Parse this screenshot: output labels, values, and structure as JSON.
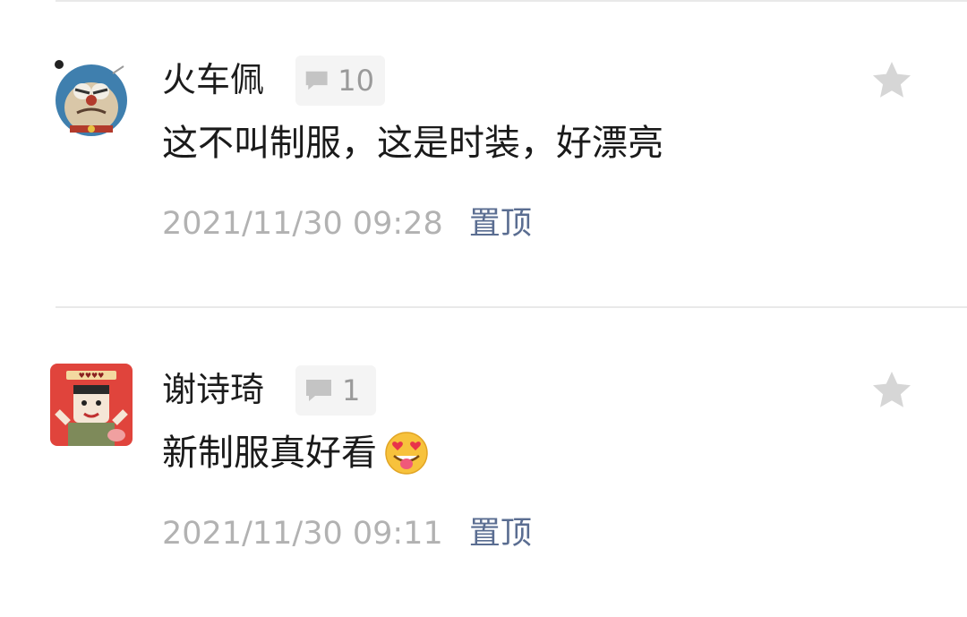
{
  "comments": [
    {
      "author": "火车佩",
      "reply_count": "10",
      "text": "这不叫制服，这是时装，好漂亮",
      "timestamp": "2021/11/30 09:28",
      "pin_label": "置顶",
      "avatar_icon": "doraemon-avatar",
      "favorite_icon": "star-icon"
    },
    {
      "author": "谢诗琦",
      "reply_count": "1",
      "text": "新制服真好看",
      "emoji": "heart-eyes-tongue-emoji",
      "timestamp": "2021/11/30 09:11",
      "pin_label": "置顶",
      "avatar_icon": "cartoon-avatar",
      "favorite_icon": "star-icon"
    }
  ],
  "colors": {
    "name": "#1c1c1c",
    "text": "#1a1a1a",
    "timestamp": "#b2b2b2",
    "pin": "#5a6d91",
    "badge_bg": "#f4f4f4",
    "star": "#d6d6d6"
  }
}
